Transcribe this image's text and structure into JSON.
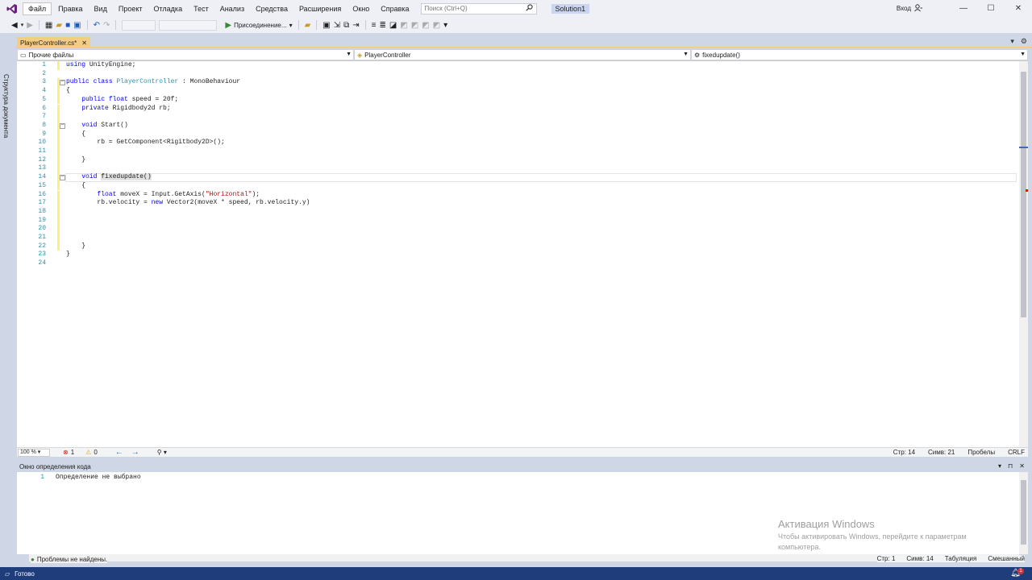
{
  "titlebar": {
    "menu": [
      "Файл",
      "Правка",
      "Вид",
      "Проект",
      "Отладка",
      "Тест",
      "Анализ",
      "Средства",
      "Расширения",
      "Окно",
      "Справка"
    ],
    "search_placeholder": "Поиск (Ctrl+Q)",
    "solution": "Solution1",
    "signin": "Вход",
    "minimize": "—",
    "maximize": "☐",
    "close": "✕"
  },
  "toolbar": {
    "attach_label": "Присоединение..."
  },
  "sidebar": {
    "label": "Структура документа"
  },
  "tab": {
    "title": "PlayerController.cs*",
    "close": "✕"
  },
  "navbar": {
    "project": "Прочие файлы",
    "class": "PlayerController",
    "member": "fixedupdate()"
  },
  "code": {
    "current_line": 14,
    "lines": [
      {
        "n": "1",
        "tokens": [
          {
            "t": "using ",
            "c": "kw"
          },
          {
            "t": "UnityEngine;",
            "c": ""
          }
        ]
      },
      {
        "n": "2",
        "tokens": []
      },
      {
        "n": "3",
        "tokens": [
          {
            "t": "public ",
            "c": "kw"
          },
          {
            "t": "class ",
            "c": "kw"
          },
          {
            "t": "PlayerController",
            "c": "ty"
          },
          {
            "t": " : MonoBehaviour",
            "c": ""
          }
        ]
      },
      {
        "n": "4",
        "tokens": [
          {
            "t": "{",
            "c": ""
          }
        ]
      },
      {
        "n": "5",
        "tokens": [
          {
            "t": "    public ",
            "c": "kw"
          },
          {
            "t": "float ",
            "c": "kw"
          },
          {
            "t": "speed = 20f;",
            "c": ""
          }
        ]
      },
      {
        "n": "6",
        "tokens": [
          {
            "t": "    private ",
            "c": "kw"
          },
          {
            "t": "Rigidbody2d rb;",
            "c": ""
          }
        ]
      },
      {
        "n": "7",
        "tokens": []
      },
      {
        "n": "8",
        "tokens": [
          {
            "t": "    void ",
            "c": "kw"
          },
          {
            "t": "Start()",
            "c": ""
          }
        ]
      },
      {
        "n": "9",
        "tokens": [
          {
            "t": "    {",
            "c": ""
          }
        ]
      },
      {
        "n": "10",
        "tokens": [
          {
            "t": "        rb = GetComponent<Rigitbody2D>();",
            "c": ""
          }
        ]
      },
      {
        "n": "11",
        "tokens": []
      },
      {
        "n": "12",
        "tokens": [
          {
            "t": "    }",
            "c": ""
          }
        ]
      },
      {
        "n": "13",
        "tokens": []
      },
      {
        "n": "14",
        "tokens": [
          {
            "t": "    void ",
            "c": "kw"
          },
          {
            "t": "fixedupdate()",
            "c": "hl"
          }
        ]
      },
      {
        "n": "15",
        "tokens": [
          {
            "t": "    {",
            "c": ""
          }
        ]
      },
      {
        "n": "16",
        "tokens": [
          {
            "t": "        float ",
            "c": "kw"
          },
          {
            "t": "moveX = Input.GetAxis(",
            "c": ""
          },
          {
            "t": "\"Horizontal\"",
            "c": "st"
          },
          {
            "t": ");",
            "c": ""
          }
        ]
      },
      {
        "n": "17",
        "tokens": [
          {
            "t": "        rb.velocity = ",
            "c": ""
          },
          {
            "t": "new ",
            "c": "kw"
          },
          {
            "t": "Vector2(moveX * speed, rb.velocity.y)",
            "c": ""
          }
        ]
      },
      {
        "n": "18",
        "tokens": []
      },
      {
        "n": "19",
        "tokens": []
      },
      {
        "n": "20",
        "tokens": []
      },
      {
        "n": "21",
        "tokens": []
      },
      {
        "n": "22",
        "tokens": [
          {
            "t": "    }",
            "c": ""
          }
        ]
      },
      {
        "n": "23",
        "tokens": [
          {
            "t": "}",
            "c": ""
          }
        ]
      },
      {
        "n": "24",
        "tokens": []
      }
    ]
  },
  "editor_status": {
    "zoom": "100 %",
    "errors": "1",
    "warnings": "0",
    "line": "Стр: 14",
    "char": "Симв: 21",
    "whitespace": "Пробелы",
    "eol": "CRLF"
  },
  "panel": {
    "title": "Окно определения кода",
    "line_no": "1",
    "text": "Определение не выбрано",
    "problems": "Проблемы не найдены.",
    "line": "Стр: 1",
    "char": "Симв: 14",
    "tabs": "Табуляция",
    "encoding": "Смешанный"
  },
  "activation": {
    "title": "Активация Windows",
    "body": "Чтобы активировать Windows, перейдите к параметрам компьютера."
  },
  "statusbar": {
    "ready": "Готово",
    "notifications": "1"
  }
}
